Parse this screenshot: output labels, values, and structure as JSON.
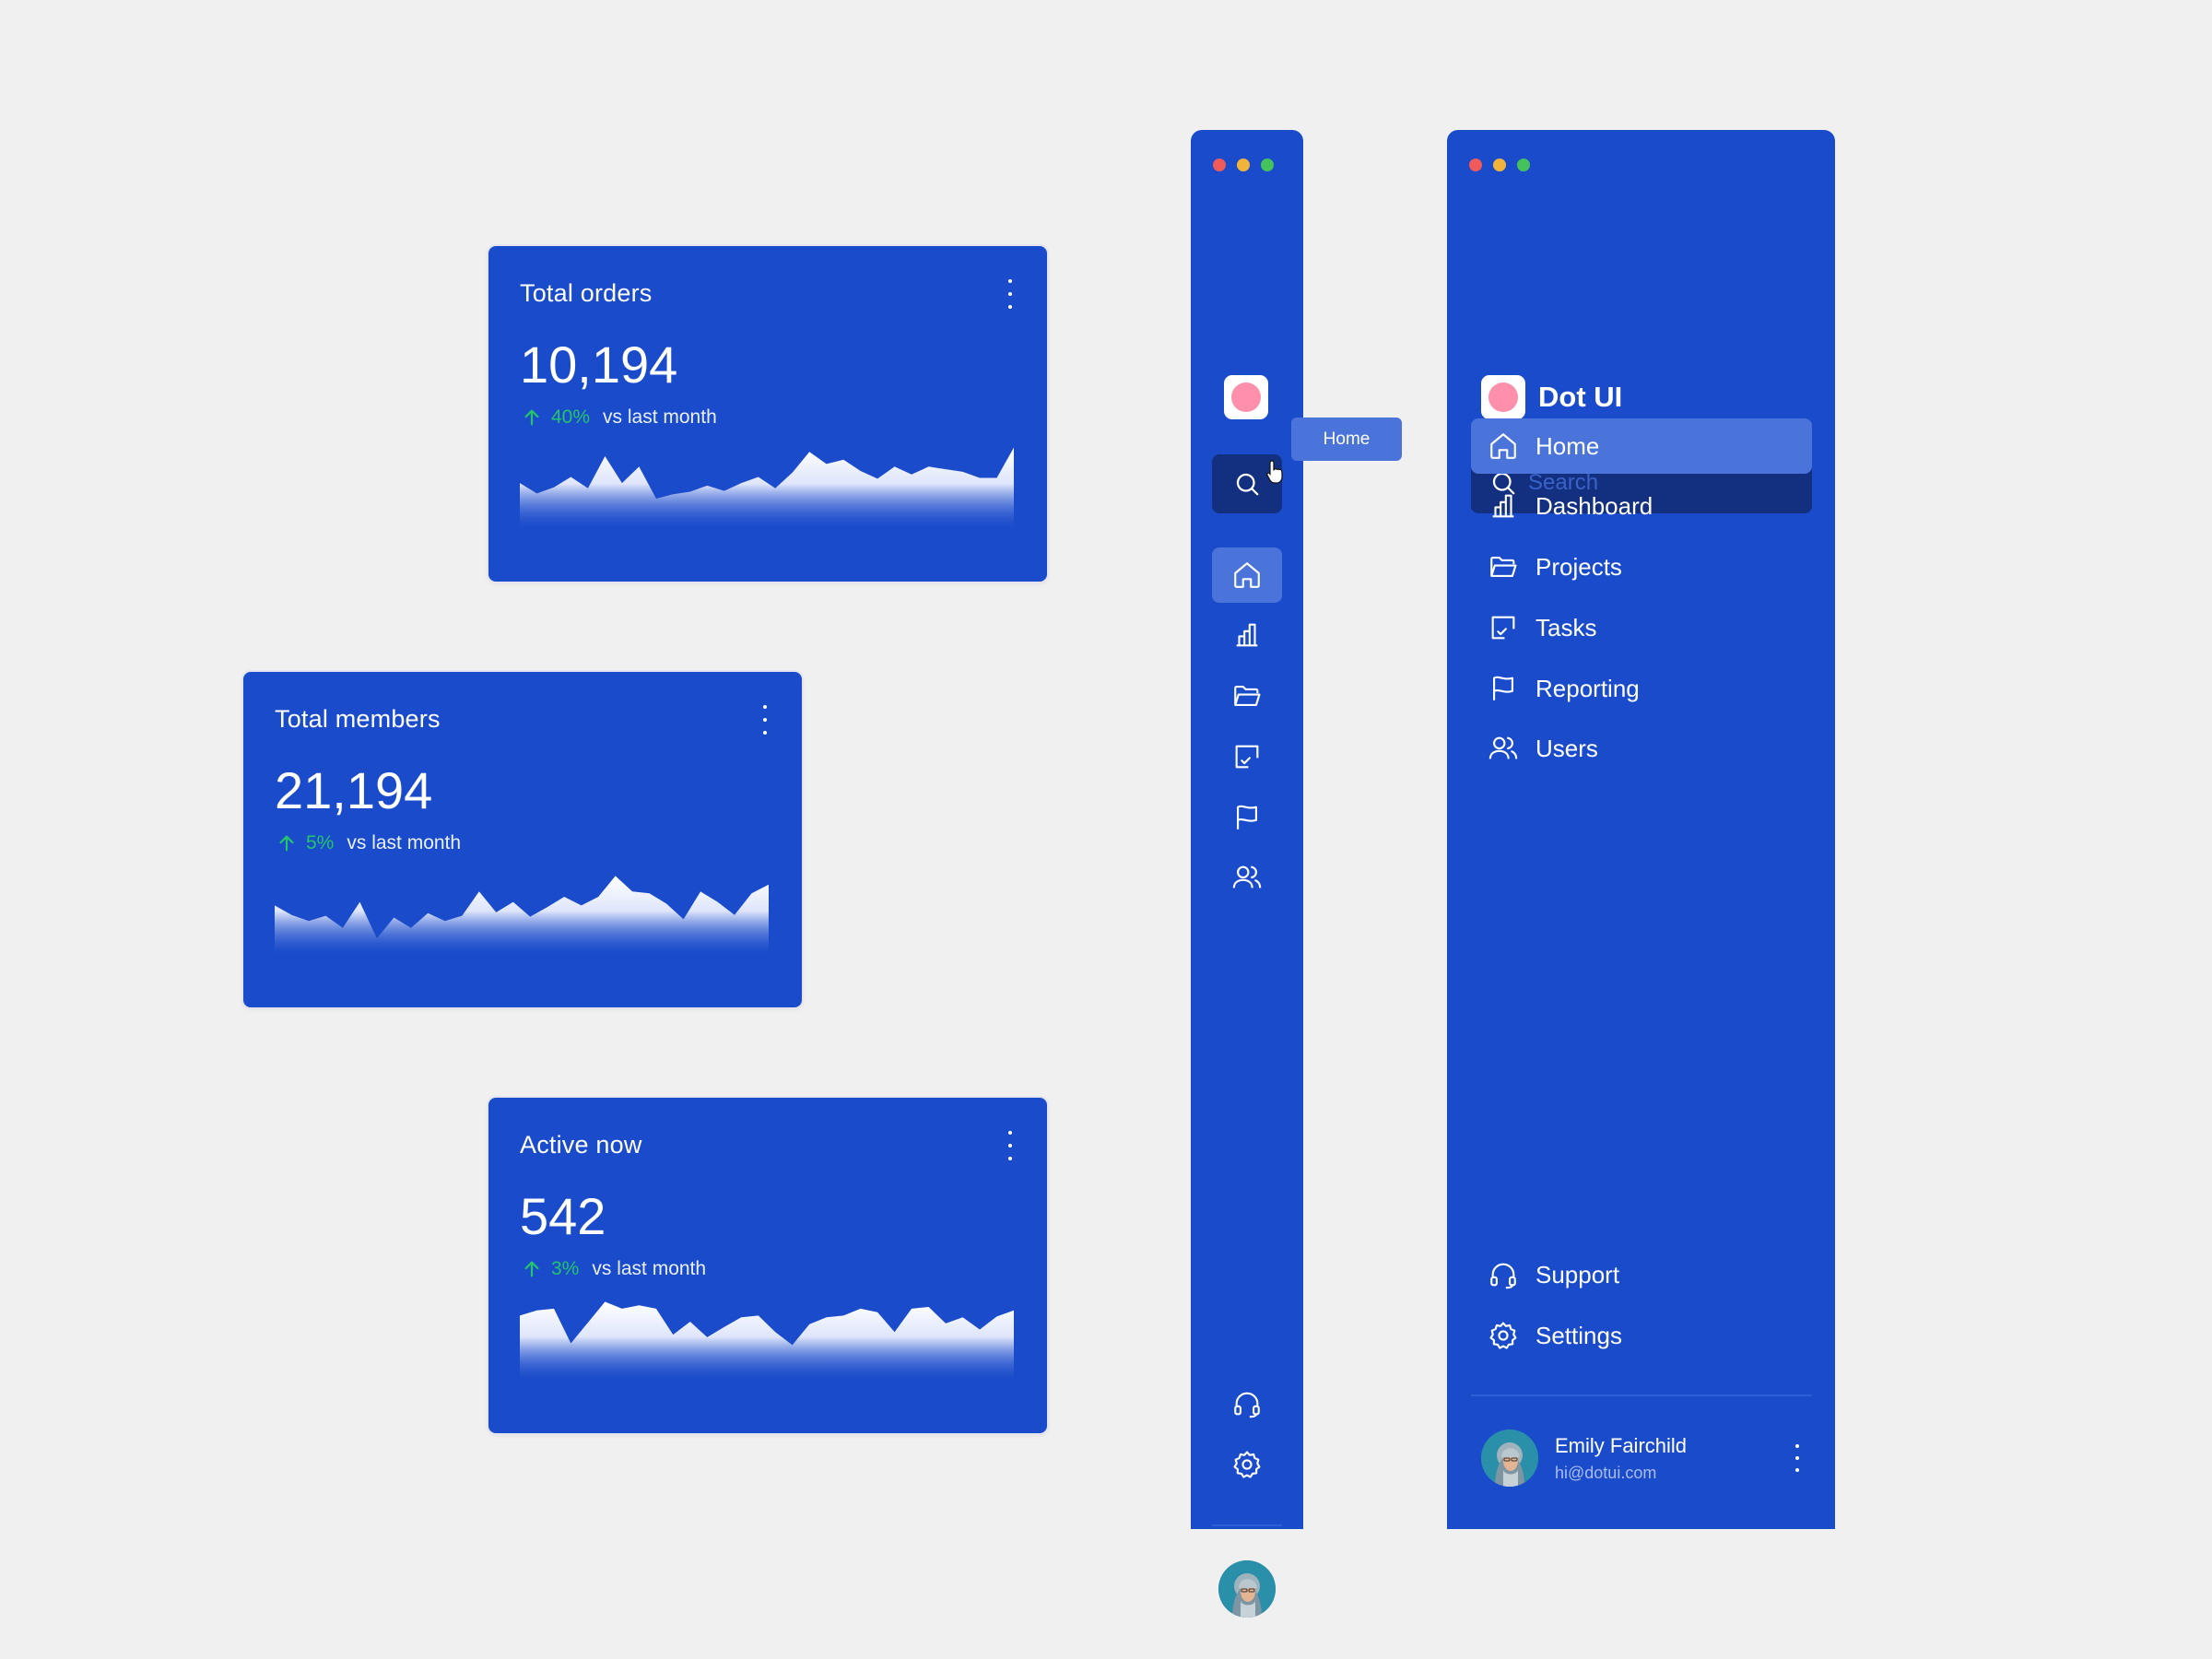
{
  "cards": [
    {
      "title": "Total orders",
      "value": "10,194",
      "delta_pct": "40%",
      "delta_text": "vs last month",
      "trend": [
        52,
        40,
        47,
        59,
        46,
        83,
        52,
        71,
        34,
        39,
        42,
        49,
        43,
        52,
        59,
        46,
        64,
        88,
        74,
        79,
        66,
        57,
        71,
        62,
        71,
        68,
        65,
        58,
        58,
        93
      ]
    },
    {
      "title": "Total members",
      "value": "21,194",
      "delta_pct": "5%",
      "delta_text": "vs last month",
      "trend": [
        56,
        45,
        38,
        44,
        30,
        60,
        18,
        42,
        30,
        47,
        38,
        44,
        72,
        48,
        60,
        43,
        54,
        66,
        56,
        66,
        90,
        72,
        70,
        58,
        40,
        72,
        60,
        45,
        70,
        80
      ]
    },
    {
      "title": "Active now",
      "value": "542",
      "delta_pct": "3%",
      "delta_text": "vs last month",
      "trend": [
        74,
        80,
        82,
        42,
        66,
        90,
        82,
        86,
        82,
        52,
        67,
        49,
        61,
        72,
        74,
        55,
        40,
        64,
        72,
        74,
        82,
        78,
        55,
        82,
        84,
        65,
        72,
        58,
        73,
        80
      ]
    }
  ],
  "colors": {
    "panel": "#1a4bcb",
    "search_bg": "#12307f",
    "active_item": "#4a74d9",
    "positive": "#23c46b",
    "logo_dot": "#ff8fab"
  },
  "collapsed_sidebar": {
    "tooltip": "Home"
  },
  "sidebar": {
    "brand": "Dot UI",
    "search_placeholder": "Search",
    "nav": [
      {
        "label": "Home",
        "icon": "home-icon",
        "active": true
      },
      {
        "label": "Dashboard",
        "icon": "bar-chart-icon"
      },
      {
        "label": "Projects",
        "icon": "folder-icon"
      },
      {
        "label": "Tasks",
        "icon": "check-square-icon"
      },
      {
        "label": "Reporting",
        "icon": "flag-icon"
      },
      {
        "label": "Users",
        "icon": "users-icon"
      }
    ],
    "footer": [
      {
        "label": "Support",
        "icon": "headphones-icon"
      },
      {
        "label": "Settings",
        "icon": "gear-icon"
      }
    ],
    "user": {
      "name": "Emily Fairchild",
      "email": "hi@dotui.com"
    }
  }
}
